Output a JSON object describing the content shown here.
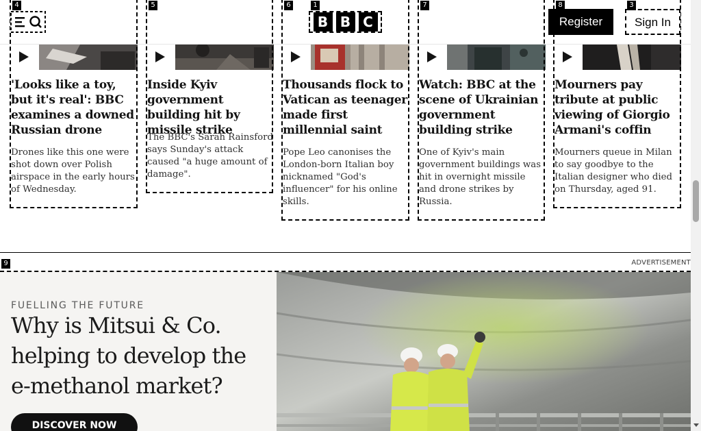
{
  "header": {
    "register_label": "Register",
    "signin_label": "Sign In",
    "logo_letters": [
      "B",
      "B",
      "C"
    ],
    "menu_icon": "menu-search-icon"
  },
  "annotations": [
    "4",
    "5",
    "6",
    "1",
    "7",
    "8",
    "3",
    "9"
  ],
  "stories": [
    {
      "title": "'Looks like a toy, but it's real': BBC examines a downed Russian drone",
      "summary": "Drones like this one were shot down over Polish airspace in the early hours of Wednesday."
    },
    {
      "title": "Inside Kyiv government building hit by missile strike",
      "summary": "The BBC's Sarah Rainsford says Sunday's attack caused \"a huge amount of damage\"."
    },
    {
      "title": "Thousands flock to Vatican as teenager made first millennial saint",
      "summary": "Pope Leo canonises the London-born Italian boy nicknamed \"God's influencer\" for his online skills."
    },
    {
      "title": "Watch: BBC at the scene of Ukrainian government building strike",
      "summary": "One of Kyiv's main government buildings was hit in overnight missile and drone strikes by Russia."
    },
    {
      "title": "Mourners pay tribute at public viewing of Giorgio Armani's coffin",
      "summary": "Mourners queue in Milan to say goodbye to the Italian designer who died on Thursday, aged 91."
    }
  ],
  "ad": {
    "label": "ADVERTISEMENT",
    "kicker": "FUELLING THE FUTURE",
    "headline": "Why is Mitsui & Co. helping to develop the e-methanol market?",
    "cta": "DISCOVER NOW"
  },
  "colors": {
    "brand_black": "#000000",
    "text": "#141414",
    "ad_background": "#f5f4f2",
    "hi_vis_jacket": "#d6e84a"
  }
}
